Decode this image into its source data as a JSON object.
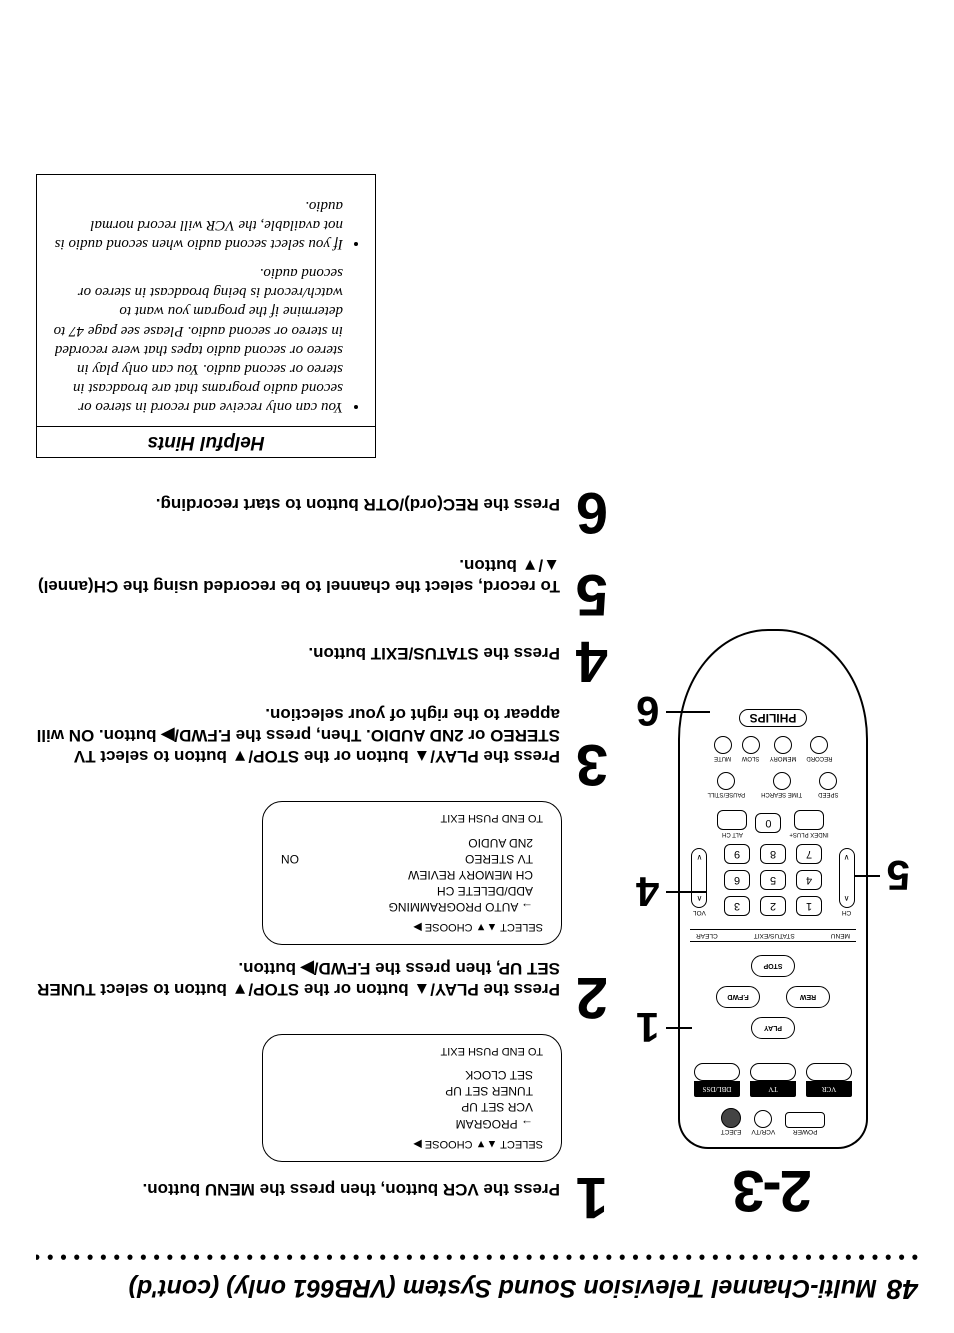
{
  "header": {
    "pagenum": "48",
    "title": "Multi-Channel Television Sound System (VRB661 only) (cont'd)"
  },
  "remote_callout_label": "2-3",
  "callouts_right": {
    "one": "1",
    "four": "4",
    "six": "6"
  },
  "callouts_left": {
    "five": "5"
  },
  "remote_labels": {
    "power": "POWER",
    "vcrtv": "VCR/TV",
    "eject": "EJECT",
    "vcr": "VCR",
    "tv": "TV",
    "dbldss": "DBL/DSS",
    "play": "PLAY",
    "rew": "REW",
    "ffwd": "F.FWD",
    "stop": "STOP",
    "menu": "MENU",
    "statusexit": "STATUS/EXIT",
    "clear": "CLEAR",
    "ch": "CH",
    "vol": "VOL",
    "indexplus": "INDEX PLUS+",
    "altch": "ALT CH",
    "speed": "SPEED",
    "timesearch": "TIME SEARCH",
    "pausestill": "PAUSE/STILL",
    "record": "RECORD",
    "memory": "MEMORY",
    "slow": "SLOW",
    "mute": "MUTE",
    "logo": "PHILIPS"
  },
  "nums": [
    "1",
    "2",
    "3",
    "4",
    "5",
    "6",
    "7",
    "8",
    "9",
    "0"
  ],
  "osd1": {
    "head": "SELECT ▲▼   CHOOSE ▶",
    "items": [
      "→ PROGRAM",
      "VCR SET UP",
      "TUNER SET UP",
      "SET CLOCK"
    ],
    "foot": "TO END PUSH EXIT"
  },
  "osd2": {
    "head": "SELECT ▲▼   CHOOSE ▶",
    "items": [
      "→ AUTO PROGRAMMING",
      "ADD/DELETE CH",
      "CH MEMORY REVIEW"
    ],
    "row1": [
      "TV STEREO",
      "ON"
    ],
    "row2": [
      "2ND AUDIO",
      ""
    ],
    "foot": "TO END PUSH EXIT"
  },
  "steps": {
    "s1": {
      "num": "1",
      "text": "Press the VCR button, then press the MENU button."
    },
    "s2": {
      "num": "2",
      "text": "Press the PLAY/▲ button or the STOP/▼ button to select TUNER SET UP, then press the F.FWD/▶ button."
    },
    "s3": {
      "num": "3",
      "text": "Press the PLAY/▲ button or the STOP/▼ button to select TV STEREO or 2ND AUDIO. Then, press the F.FWD/▶ button. ON will appear to the right of your selection."
    },
    "s4": {
      "num": "4",
      "text": "Press the STATUS/EXIT button."
    },
    "s5": {
      "num": "5",
      "text": "To record, select the channel to be recorded using the CH(annel) ▲/▼ button."
    },
    "s6": {
      "num": "6",
      "text": "Press the REC(ord)/OTR button to start recording."
    }
  },
  "hints": {
    "title": "Helpful Hints",
    "b1": "You can only receive and record in stereo or second audio programs that are broadcast in stereo or second audio. You can only play in stereo or second audio tapes that were recorded in stereo or second audio. Please see page 47 to determine if the program you want to watch/record is being broadcast in stereo or second audio.",
    "b2": "If you select second audio when second audio is not available, the VCR will record normal audio."
  }
}
